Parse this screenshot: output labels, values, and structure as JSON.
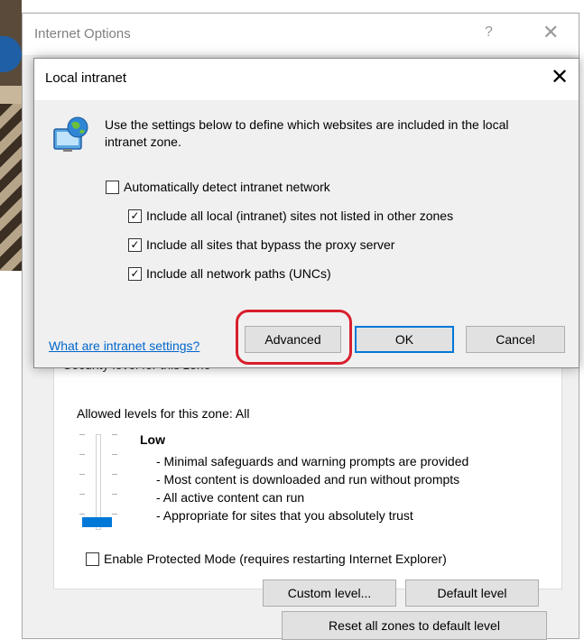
{
  "parent_dialog": {
    "title": "Internet Options",
    "help_label": "?",
    "close_label": "✕",
    "group_label": "Security level for this zone",
    "allowed_levels": "Allowed levels for this zone: All",
    "level_name": "Low",
    "level_description": [
      "- Minimal safeguards and warning prompts are provided",
      "- Most content is downloaded and run without prompts",
      "- All active content can run",
      "- Appropriate for sites that you absolutely trust"
    ],
    "slider_level": 0,
    "protected_mode_label": "Enable Protected Mode (requires restarting Internet Explorer)",
    "protected_mode_checked": false,
    "custom_level_label": "Custom level...",
    "default_level_label": "Default level",
    "reset_all_label": "Reset all zones to default level"
  },
  "child_dialog": {
    "title": "Local intranet",
    "close_label": "✕",
    "description": "Use the settings below to define which websites are included in the local intranet zone.",
    "checkboxes": [
      {
        "label": "Automatically detect intranet network",
        "checked": false
      },
      {
        "label": "Include all local (intranet) sites not listed in other zones",
        "checked": true
      },
      {
        "label": "Include all sites that bypass the proxy server",
        "checked": true
      },
      {
        "label": "Include all network paths (UNCs)",
        "checked": true
      }
    ],
    "link_label": "What are intranet settings?",
    "advanced_label": "Advanced",
    "ok_label": "OK",
    "cancel_label": "Cancel"
  },
  "colors": {
    "highlight": "#d81e2c",
    "accent": "#0078d7",
    "link": "#0066cc"
  },
  "icons": {
    "zone_icon": "globe-computer-icon",
    "check_mark": "✓"
  }
}
